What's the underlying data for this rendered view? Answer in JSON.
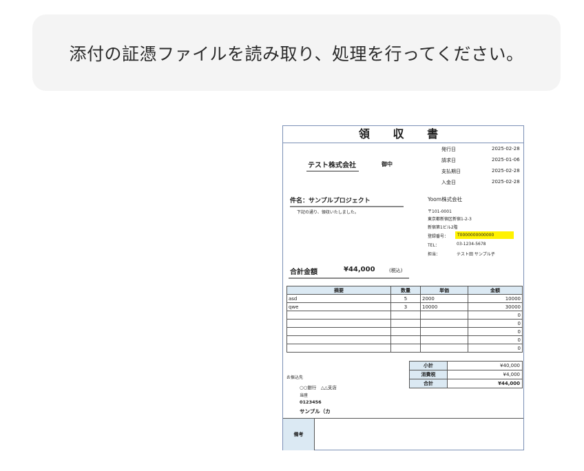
{
  "message": {
    "text": "添付の証憑ファイルを読み取り、処理を行ってください。"
  },
  "receipt": {
    "title": "領 収 書",
    "recipient": {
      "name": "テスト株式会社",
      "honorific": "御中"
    },
    "dates": [
      {
        "label": "発行日",
        "value": "2025-02-28"
      },
      {
        "label": "請求日",
        "value": "2025-01-06"
      },
      {
        "label": "支払期日",
        "value": "2025-02-28"
      },
      {
        "label": "入金日",
        "value": "2025-02-28"
      }
    ],
    "subject": "件名：サンプルプロジェクト",
    "note": "下記の通り、領収いたしました。",
    "issuer": {
      "company": "Yoom株式会社",
      "postal": "〒101-0001",
      "address1": "東京都新宿区新宿1-2-3",
      "address2": "新宿第1ビル2階",
      "reg_label": "登録番号：",
      "reg_value": "T0000000000000",
      "tel_label": "TEL：",
      "tel_value": "03-1234-5678",
      "staff_label": "担当：",
      "staff_value": "テスト田 サンプル子"
    },
    "total": {
      "label": "合計金額",
      "value": "¥44,000",
      "tax_note": "(税込)"
    },
    "table": {
      "headers": [
        "摘要",
        "数量",
        "単価",
        "金額"
      ],
      "rows": [
        [
          "asd",
          "5",
          "2000",
          "10000"
        ],
        [
          "qwe",
          "3",
          "10000",
          "30000"
        ],
        [
          "",
          "",
          "",
          "0"
        ],
        [
          "",
          "",
          "",
          "0"
        ],
        [
          "",
          "",
          "",
          "0"
        ],
        [
          "",
          "",
          "",
          "0"
        ],
        [
          "",
          "",
          "",
          "0"
        ]
      ]
    },
    "summary": [
      {
        "label": "小計",
        "value": "¥40,000"
      },
      {
        "label": "消費税",
        "value": "¥4,000"
      },
      {
        "label": "合計",
        "value": "¥44,000"
      }
    ],
    "bank": {
      "label": "お振込先",
      "bank": "○○銀行　△△支店",
      "type": "当座",
      "number": "0123456",
      "holder": "サンプル（カ"
    },
    "remarks_label": "備考"
  }
}
